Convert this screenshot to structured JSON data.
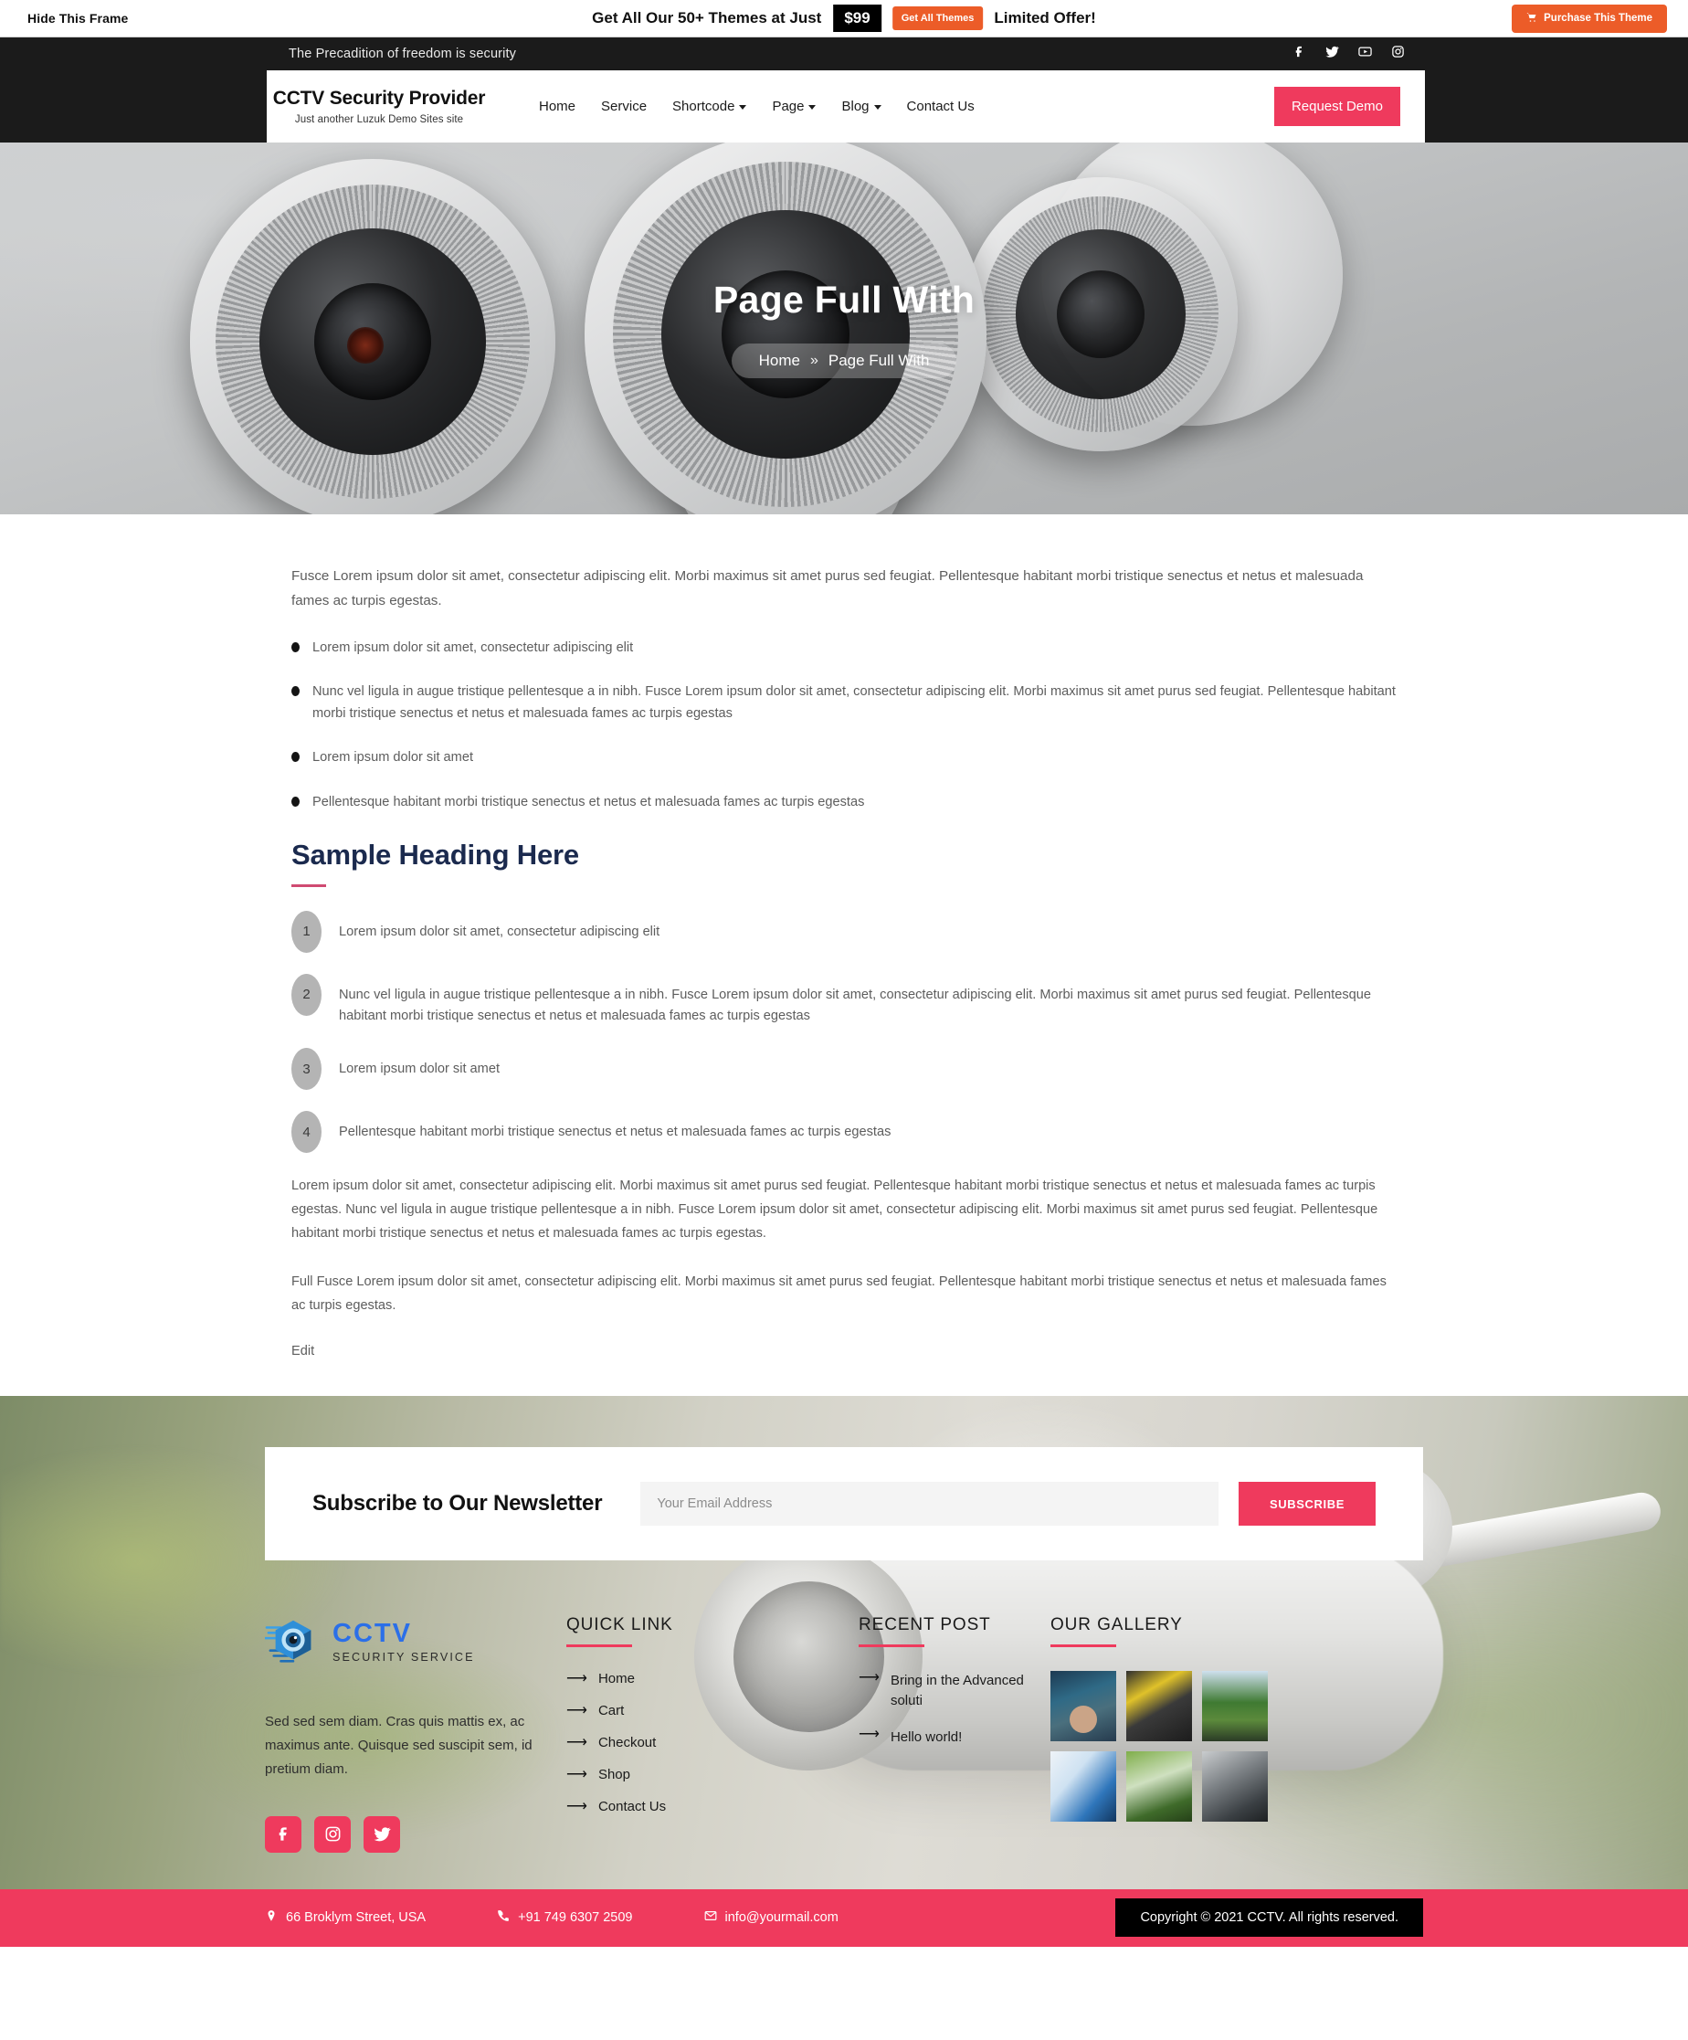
{
  "frame_bar": {
    "hide_label": "Hide This Frame",
    "offer_text": "Get All Our 50+ Themes at Just",
    "price": "$99",
    "get_all_label": "Get All Themes",
    "limited_label": "Limited Offer!",
    "purchase_label": "Purchase This Theme",
    "cart_icon": "cart-icon",
    "accent": "#ec5c28"
  },
  "topbar": {
    "tagline": "The Precadition of freedom is security",
    "socials": [
      {
        "name": "facebook-icon",
        "label": "Facebook"
      },
      {
        "name": "twitter-icon",
        "label": "Twitter"
      },
      {
        "name": "youtube-icon",
        "label": "YouTube"
      },
      {
        "name": "instagram-icon",
        "label": "Instagram"
      }
    ]
  },
  "header": {
    "brand_title": "CCTV Security Provider",
    "brand_tagline": "Just another Luzuk Demo Sites site",
    "nav": [
      {
        "label": "Home",
        "has_dropdown": false
      },
      {
        "label": "Service",
        "has_dropdown": false
      },
      {
        "label": "Shortcode",
        "has_dropdown": true
      },
      {
        "label": "Page",
        "has_dropdown": true
      },
      {
        "label": "Blog",
        "has_dropdown": true
      },
      {
        "label": "Contact Us",
        "has_dropdown": false
      }
    ],
    "cta_label": "Request Demo",
    "accent": "#ef3a5d"
  },
  "hero": {
    "title": "Page Full With",
    "breadcrumb_home": "Home",
    "breadcrumb_sep": "»",
    "breadcrumb_current": "Page Full With"
  },
  "main": {
    "intro": "Fusce Lorem ipsum dolor sit amet, consectetur adipiscing elit. Morbi maximus sit amet purus sed feugiat. Pellentesque habitant morbi tristique senectus et netus et malesuada fames ac turpis egestas.",
    "bullets": [
      "Lorem ipsum dolor sit amet, consectetur adipiscing elit",
      "Nunc vel ligula in augue tristique pellentesque a in nibh. Fusce Lorem ipsum dolor sit amet, consectetur adipiscing elit. Morbi maximus sit amet purus sed feugiat. Pellentesque habitant morbi tristique senectus et netus et malesuada fames ac turpis egestas",
      "Lorem ipsum dolor sit amet",
      "Pellentesque habitant morbi tristique senectus et netus et malesuada fames ac turpis egestas"
    ],
    "heading": "Sample Heading Here",
    "numbered": [
      {
        "n": "1",
        "text": "Lorem ipsum dolor sit amet, consectetur adipiscing elit"
      },
      {
        "n": "2",
        "text": "Nunc vel ligula in augue tristique pellentesque a in nibh. Fusce Lorem ipsum dolor sit amet, consectetur adipiscing elit. Morbi maximus sit amet purus sed feugiat. Pellentesque habitant morbi tristique senectus et netus et malesuada fames ac turpis egestas"
      },
      {
        "n": "3",
        "text": "Lorem ipsum dolor sit amet"
      },
      {
        "n": "4",
        "text": "Pellentesque habitant morbi tristique senectus et netus et malesuada fames ac turpis egestas"
      }
    ],
    "para_1": "Lorem ipsum dolor sit amet, consectetur adipiscing elit. Morbi maximus sit amet purus sed feugiat. Pellentesque habitant morbi tristique senectus et netus et malesuada fames ac turpis egestas. Nunc vel ligula in augue tristique pellentesque a in nibh. Fusce Lorem ipsum dolor sit amet, consectetur adipiscing elit. Morbi maximus sit amet purus sed feugiat. Pellentesque habitant morbi tristique senectus et netus et malesuada fames ac turpis egestas.",
    "para_2": "Full Fusce Lorem ipsum dolor sit amet, consectetur adipiscing elit. Morbi maximus sit amet purus sed feugiat. Pellentesque habitant morbi tristique senectus et netus et malesuada fames ac turpis egestas.",
    "edit_label": "Edit"
  },
  "newsletter": {
    "title": "Subscribe to Our Newsletter",
    "placeholder": "Your Email Address",
    "input_value": "",
    "button_label": "SUBSCRIBE"
  },
  "footer": {
    "logo_big": "CCTV",
    "logo_small": "SECURITY SERVICE",
    "logo_icon": "cctv-eye-logo-icon",
    "about": "Sed sed sem diam. Cras quis mattis ex, ac maximus ante. Quisque sed suscipit sem, id pretium diam.",
    "socials": [
      {
        "name": "facebook-icon",
        "label": "Facebook"
      },
      {
        "name": "instagram-icon",
        "label": "Instagram"
      },
      {
        "name": "twitter-icon",
        "label": "Twitter"
      }
    ],
    "quick_title": "QUICK LINK",
    "quick_links": [
      "Home",
      "Cart",
      "Checkout",
      "Shop",
      "Contact Us"
    ],
    "recent_title": "RECENT POST",
    "recent_posts": [
      "Bring in the Advanced soluti",
      "Hello world!"
    ],
    "gallery_title": "OUR GALLERY",
    "gallery": [
      "technician-server-room",
      "cable-tools-installation",
      "outdoor-gate-camera",
      "security-lock-network",
      "white-camera-foliage",
      "camera-closeup-screwdriver"
    ]
  },
  "bottom": {
    "address": "66 Broklym Street, USA",
    "address_icon": "location-pin-icon",
    "phone": "+91 749 6307 2509",
    "phone_icon": "phone-icon",
    "email": "info@yourmail.com",
    "email_icon": "envelope-icon",
    "copyright": "Copyright © 2021 CCTV. All rights reserved."
  }
}
